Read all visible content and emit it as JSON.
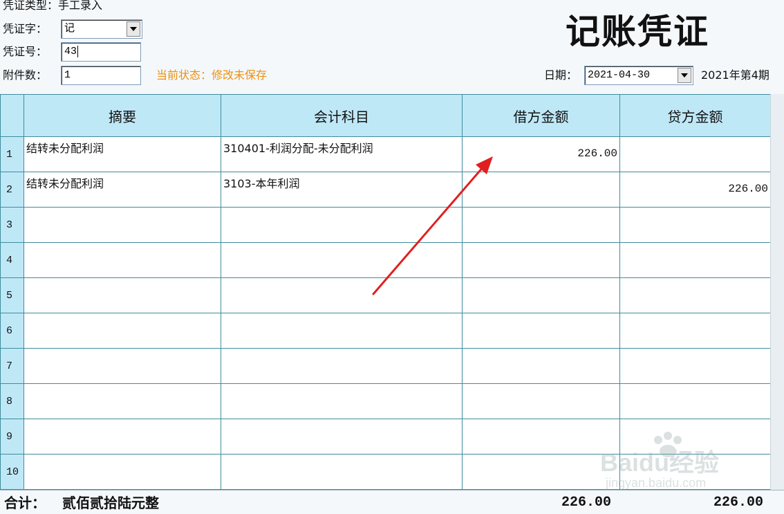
{
  "header": {
    "voucher_type_label": "凭证类型：",
    "voucher_type_value": "手工录入",
    "voucher_word_label": "凭证字：",
    "voucher_word_value": "记",
    "voucher_no_label": "凭证号：",
    "voucher_no_value": "43",
    "attachments_label": "附件数：",
    "attachments_value": "1",
    "status_text": "当前状态：修改未保存",
    "title": "记账凭证",
    "date_label": "日期：",
    "date_value": "2021-04-30",
    "period_text": "2021年第4期"
  },
  "table": {
    "columns": [
      "摘要",
      "会计科目",
      "借方金额",
      "贷方金额"
    ],
    "rows": [
      {
        "no": "1",
        "summary": "结转未分配利润",
        "account": "310401-利润分配-未分配利润",
        "debit": "226.00",
        "credit": ""
      },
      {
        "no": "2",
        "summary": "结转未分配利润",
        "account": "3103-本年利润",
        "debit": "",
        "credit": "226.00"
      },
      {
        "no": "3",
        "summary": "",
        "account": "",
        "debit": "",
        "credit": ""
      },
      {
        "no": "4",
        "summary": "",
        "account": "",
        "debit": "",
        "credit": ""
      },
      {
        "no": "5",
        "summary": "",
        "account": "",
        "debit": "",
        "credit": ""
      },
      {
        "no": "6",
        "summary": "",
        "account": "",
        "debit": "",
        "credit": ""
      },
      {
        "no": "7",
        "summary": "",
        "account": "",
        "debit": "",
        "credit": ""
      },
      {
        "no": "8",
        "summary": "",
        "account": "",
        "debit": "",
        "credit": ""
      },
      {
        "no": "9",
        "summary": "",
        "account": "",
        "debit": "",
        "credit": ""
      },
      {
        "no": "10",
        "summary": "",
        "account": "",
        "debit": "",
        "credit": ""
      }
    ]
  },
  "footer": {
    "total_label": "合计：",
    "total_words": "贰佰贰拾陆元整",
    "total_debit": "226.00",
    "total_credit": "226.00"
  },
  "watermark": {
    "line1": "Baidu经验",
    "line2": "jingyan.baidu.com"
  },
  "colors": {
    "header_bg": "#bfe8f7",
    "grid_line": "#3f8c9c",
    "status": "#f0900c",
    "arrow": "#e02020"
  },
  "icons": [
    "chevron-down-icon",
    "red-arrow-annotation"
  ]
}
